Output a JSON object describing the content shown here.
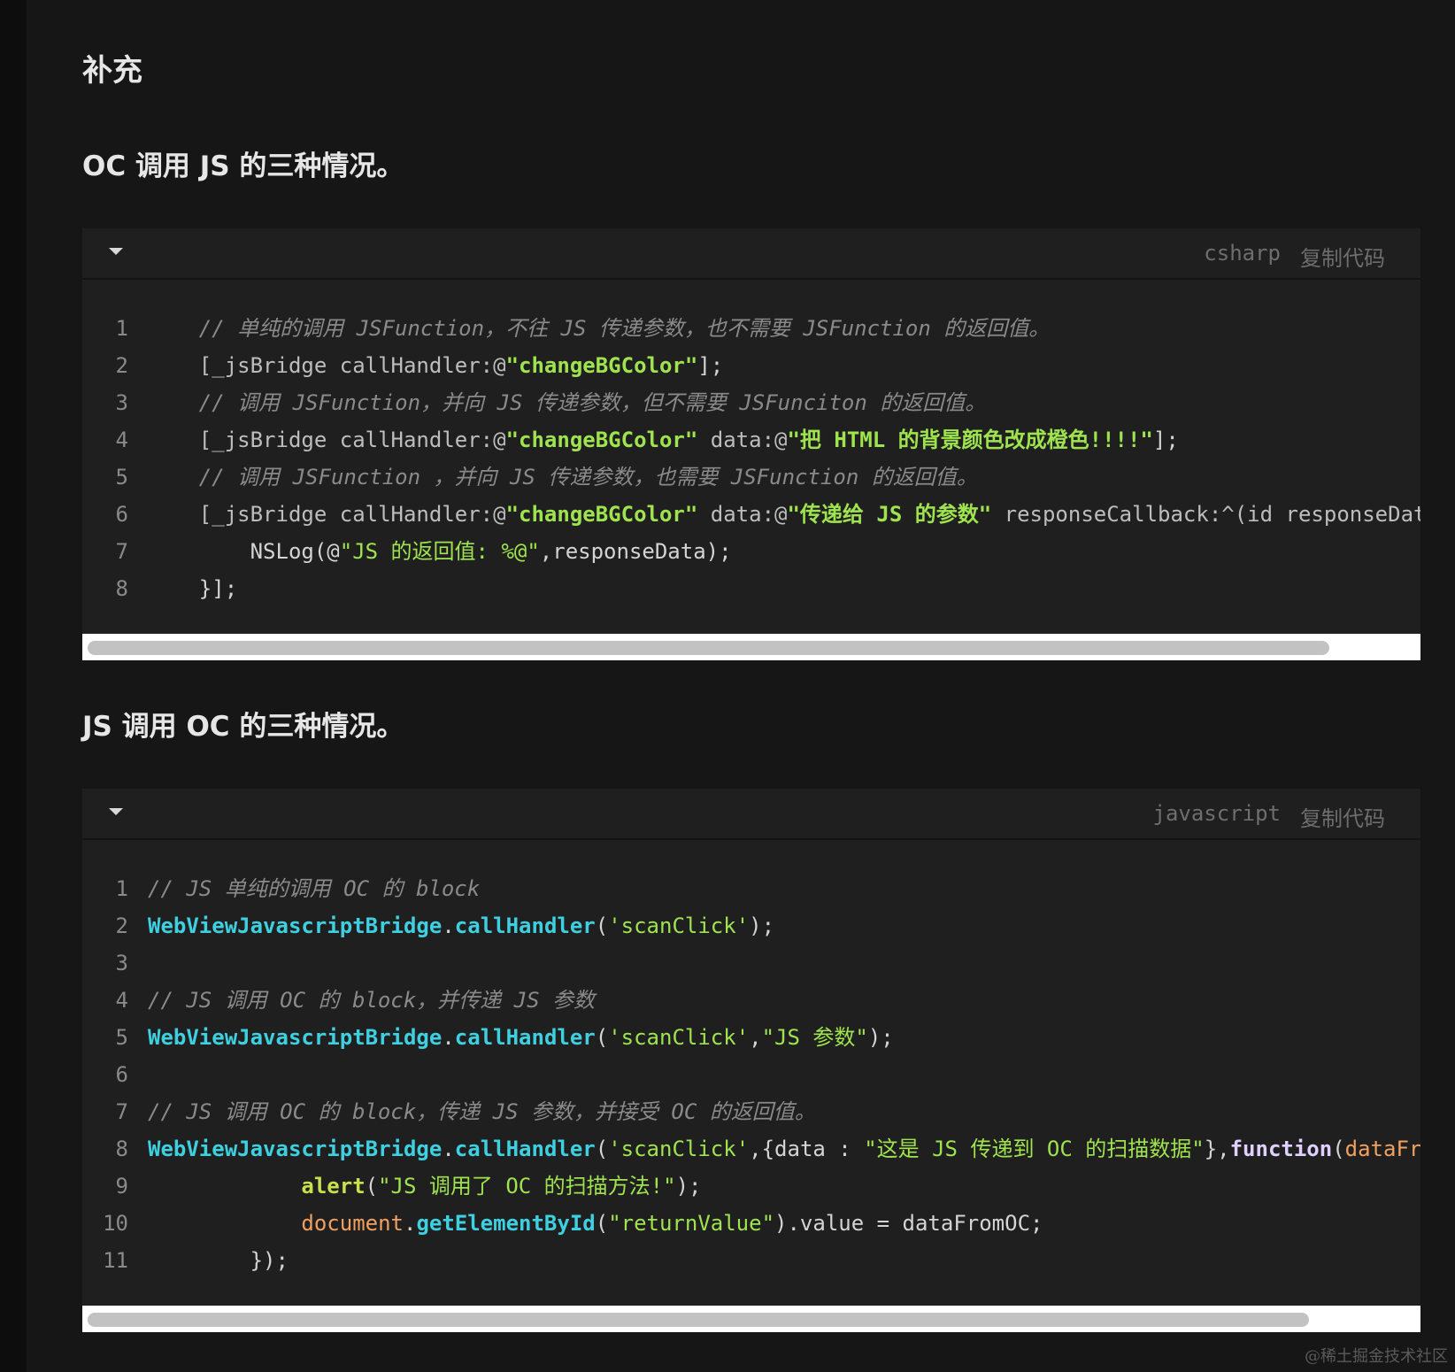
{
  "section_title": "补充",
  "blocks": [
    {
      "heading": "OC 调用 JS 的三种情况。",
      "language": "csharp",
      "copy_label": "复制代码",
      "lines": [
        {
          "n": "1",
          "tokens": [
            {
              "t": "    // 单纯的调用 JSFunction，不往 JS 传递参数，也不需要 JSFunction 的返回值。",
              "c": "c-com"
            }
          ]
        },
        {
          "n": "2",
          "tokens": [
            {
              "t": "    [_jsBridge callHandler:@",
              "c": "c-gray"
            },
            {
              "t": "\"changeBGColor\"",
              "c": "c-str-b"
            },
            {
              "t": "];",
              "c": "c-plain"
            }
          ]
        },
        {
          "n": "3",
          "tokens": [
            {
              "t": "    // 调用 JSFunction，并向 JS 传递参数，但不需要 JSFunciton 的返回值。",
              "c": "c-com"
            }
          ]
        },
        {
          "n": "4",
          "tokens": [
            {
              "t": "    [_jsBridge callHandler:@",
              "c": "c-gray"
            },
            {
              "t": "\"changeBGColor\"",
              "c": "c-str-b"
            },
            {
              "t": " data:@",
              "c": "c-gray"
            },
            {
              "t": "\"把 HTML 的背景颜色改成橙色!!!!\"",
              "c": "c-str-b"
            },
            {
              "t": "];",
              "c": "c-plain"
            }
          ]
        },
        {
          "n": "5",
          "tokens": [
            {
              "t": "    // 调用 JSFunction ，并向 JS 传递参数，也需要 JSFunction 的返回值。",
              "c": "c-com"
            }
          ]
        },
        {
          "n": "6",
          "tokens": [
            {
              "t": "    [_jsBridge callHandler:@",
              "c": "c-gray"
            },
            {
              "t": "\"changeBGColor\"",
              "c": "c-str-b"
            },
            {
              "t": " data:@",
              "c": "c-gray"
            },
            {
              "t": "\"传递给 JS 的参数\"",
              "c": "c-str-b"
            },
            {
              "t": " responseCallback:^(id responseData",
              "c": "c-gray"
            }
          ]
        },
        {
          "n": "7",
          "tokens": [
            {
              "t": "        NSLog(@",
              "c": "c-plain"
            },
            {
              "t": "\"JS 的返回值: %@\"",
              "c": "c-str"
            },
            {
              "t": ",responseData);",
              "c": "c-plain"
            }
          ]
        },
        {
          "n": "8",
          "tokens": [
            {
              "t": "    }];",
              "c": "c-plain"
            }
          ]
        }
      ],
      "scroll_fraction": 0.935
    },
    {
      "heading": "JS 调用 OC 的三种情况。",
      "language": "javascript",
      "copy_label": "复制代码",
      "lines": [
        {
          "n": "1",
          "tokens": [
            {
              "t": "// JS 单纯的调用 OC 的 block",
              "c": "c-com"
            }
          ]
        },
        {
          "n": "2",
          "tokens": [
            {
              "t": "WebViewJavascriptBridge",
              "c": "c-cyan"
            },
            {
              "t": ".",
              "c": "c-plain"
            },
            {
              "t": "callHandler",
              "c": "c-cyan"
            },
            {
              "t": "(",
              "c": "c-plain"
            },
            {
              "t": "'scanClick'",
              "c": "c-str"
            },
            {
              "t": ");",
              "c": "c-plain"
            }
          ]
        },
        {
          "n": "3",
          "tokens": [
            {
              "t": "",
              "c": "c-plain"
            }
          ]
        },
        {
          "n": "4",
          "tokens": [
            {
              "t": "// JS 调用 OC 的 block，并传递 JS 参数",
              "c": "c-com"
            }
          ]
        },
        {
          "n": "5",
          "tokens": [
            {
              "t": "WebViewJavascriptBridge",
              "c": "c-cyan"
            },
            {
              "t": ".",
              "c": "c-plain"
            },
            {
              "t": "callHandler",
              "c": "c-cyan"
            },
            {
              "t": "(",
              "c": "c-plain"
            },
            {
              "t": "'scanClick'",
              "c": "c-str"
            },
            {
              "t": ",",
              "c": "c-plain"
            },
            {
              "t": "\"JS 参数\"",
              "c": "c-str"
            },
            {
              "t": ");",
              "c": "c-plain"
            }
          ]
        },
        {
          "n": "6",
          "tokens": [
            {
              "t": "",
              "c": "c-plain"
            }
          ]
        },
        {
          "n": "7",
          "tokens": [
            {
              "t": "// JS 调用 OC 的 block，传递 JS 参数，并接受 OC 的返回值。",
              "c": "c-com"
            }
          ]
        },
        {
          "n": "8",
          "tokens": [
            {
              "t": "WebViewJavascriptBridge",
              "c": "c-cyan"
            },
            {
              "t": ".",
              "c": "c-plain"
            },
            {
              "t": "callHandler",
              "c": "c-cyan"
            },
            {
              "t": "(",
              "c": "c-plain"
            },
            {
              "t": "'scanClick'",
              "c": "c-str"
            },
            {
              "t": ",{data : ",
              "c": "c-plain"
            },
            {
              "t": "\"这是 JS 传递到 OC 的扫描数据\"",
              "c": "c-str"
            },
            {
              "t": "},",
              "c": "c-plain"
            },
            {
              "t": "function",
              "c": "c-kw"
            },
            {
              "t": "(",
              "c": "c-plain"
            },
            {
              "t": "dataFromOC",
              "c": "c-orange"
            }
          ]
        },
        {
          "n": "9",
          "tokens": [
            {
              "t": "            ",
              "c": "c-plain"
            },
            {
              "t": "alert",
              "c": "c-yellow"
            },
            {
              "t": "(",
              "c": "c-plain"
            },
            {
              "t": "\"JS 调用了 OC 的扫描方法!\"",
              "c": "c-str"
            },
            {
              "t": ");",
              "c": "c-plain"
            }
          ]
        },
        {
          "n": "10",
          "tokens": [
            {
              "t": "            ",
              "c": "c-plain"
            },
            {
              "t": "document",
              "c": "c-orange"
            },
            {
              "t": ".",
              "c": "c-plain"
            },
            {
              "t": "getElementById",
              "c": "c-cyan"
            },
            {
              "t": "(",
              "c": "c-plain"
            },
            {
              "t": "\"returnValue\"",
              "c": "c-str"
            },
            {
              "t": ").value = dataFromOC;",
              "c": "c-plain"
            }
          ]
        },
        {
          "n": "11",
          "tokens": [
            {
              "t": "        });",
              "c": "c-plain"
            }
          ]
        }
      ],
      "scroll_fraction": 0.92
    }
  ],
  "watermark": "@稀土掘金技术社区"
}
